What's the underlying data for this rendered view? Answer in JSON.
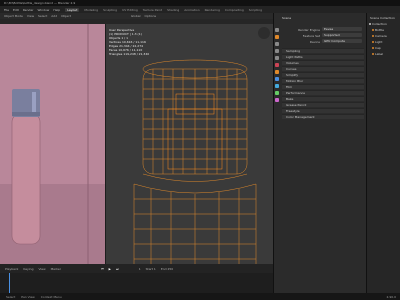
{
  "window": {
    "title": "D:\\3D\\Bottle\\bottle_design.blend — Blender 2.9"
  },
  "menu": {
    "items": [
      "File",
      "Edit",
      "Render",
      "Window",
      "Help"
    ],
    "workspaces": [
      "Layout",
      "Modeling",
      "Sculpting",
      "UV Editing",
      "Texture Paint",
      "Shading",
      "Animation",
      "Rendering",
      "Compositing",
      "Scripting"
    ],
    "active_workspace": "Layout"
  },
  "viewport": {
    "toolbar_left": [
      "Object Mode",
      "View",
      "Select",
      "Add",
      "Object"
    ],
    "toolbar_right": [
      "Global",
      "Options"
    ],
    "info": {
      "view": "User Perspective",
      "collection": "(1) PRODUCT | 1.3 (1)",
      "objects_label": "Objects",
      "objects_value": "1 / 1",
      "vertices_label": "Vertices",
      "vertices_value": "10,616 / 11,116",
      "edges_label": "Edges",
      "edges_value": "21,344 / 22,274",
      "faces_label": "Faces",
      "faces_value": "10,676 / 11,110",
      "triangles_label": "Triangles",
      "triangles_value": "119,248 / 21,340"
    }
  },
  "timeline": {
    "items": [
      "Playback",
      "Keying",
      "View",
      "Marker"
    ],
    "frame": "1",
    "start": "Start 1",
    "end": "End 250"
  },
  "properties": {
    "header": "Scene",
    "rows": [
      {
        "label": "Render Engine",
        "value": "Eevee"
      },
      {
        "label": "Feature Set",
        "value": "Supported"
      },
      {
        "label": "Device",
        "value": "GPU Compute"
      }
    ],
    "panels": [
      "Sampling",
      "Light Paths",
      "Volumes",
      "Curves",
      "Simplify",
      "Motion Blur",
      "Film",
      "Performance",
      "Bake",
      "Grease Pencil",
      "Freestyle",
      "Color Management"
    ]
  },
  "outliner": {
    "items": [
      "Scene Collection",
      "Collection",
      "Bottle",
      "Camera",
      "Light",
      "Cap",
      "Label"
    ]
  },
  "status": {
    "left": "Select",
    "middle": "Pan View",
    "right": "Context Menu",
    "version": "2.90.0"
  },
  "colors": {
    "accent": "#ff8c1a",
    "wire": "#e0892a",
    "left_view": "#b9879a"
  }
}
